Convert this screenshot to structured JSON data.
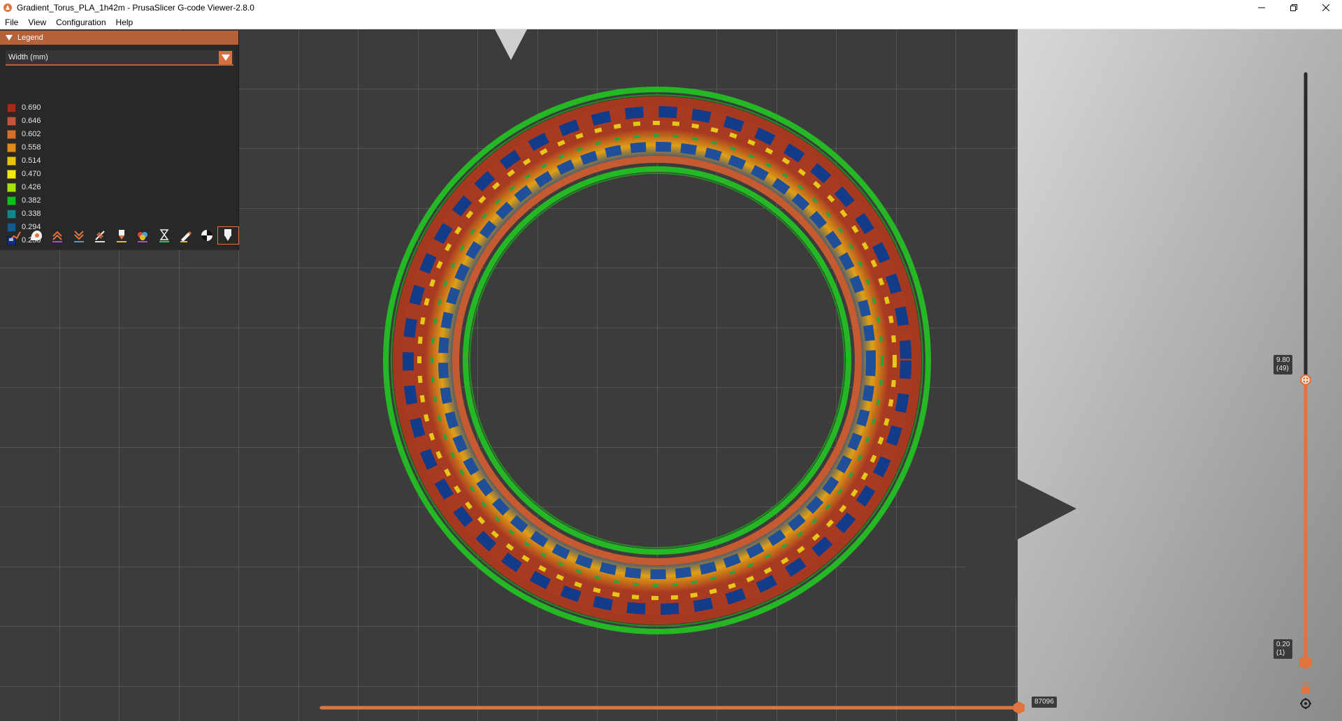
{
  "window": {
    "title": "Gradient_Torus_PLA_1h42m - PrusaSlicer G-code Viewer-2.8.0",
    "minimize_icon": "minimize-icon",
    "maximize_icon": "restore-icon",
    "close_icon": "close-icon"
  },
  "menu": {
    "items": [
      {
        "label": "File"
      },
      {
        "label": "View"
      },
      {
        "label": "Configuration"
      },
      {
        "label": "Help"
      }
    ]
  },
  "legend": {
    "title": "Legend",
    "view_type": "Width (mm)",
    "entries": [
      {
        "value": "0.690",
        "color": "#a32a1a"
      },
      {
        "value": "0.646",
        "color": "#c4553d"
      },
      {
        "value": "0.602",
        "color": "#d0702d"
      },
      {
        "value": "0.558",
        "color": "#e18a18"
      },
      {
        "value": "0.514",
        "color": "#ebc20a"
      },
      {
        "value": "0.470",
        "color": "#f3e80c"
      },
      {
        "value": "0.426",
        "color": "#a8e20f"
      },
      {
        "value": "0.382",
        "color": "#0fbf1c"
      },
      {
        "value": "0.338",
        "color": "#12868a"
      },
      {
        "value": "0.294",
        "color": "#135a8c"
      },
      {
        "value": "0.250",
        "color": "#0b2e84"
      }
    ],
    "toolbar_icons": [
      "travel-icon",
      "wipe-icon",
      "retractions-icon",
      "deretractions-icon",
      "seams-icon",
      "tool-changes-icon",
      "color-changes-icon",
      "pause-prints-icon",
      "custom-gcodes-icon",
      "center-of-gravity-icon",
      "tool-marker-icon"
    ]
  },
  "vertical_slider": {
    "upper_value": "9.80",
    "upper_layer": "(49)",
    "lower_value": "0.20",
    "lower_layer": "(1)",
    "upper_fraction": 0.48,
    "lower_fraction": 0.0,
    "lock_icon": "unlock-icon",
    "settings_icon": "cog-icon"
  },
  "horizontal_slider": {
    "value": "87096",
    "fraction": 1.0
  },
  "colors": {
    "accent": "#e0743e",
    "bed_background": "#3c3c3c",
    "grid_line": "#6a6a6a",
    "perimeter_green": "#2fbf2f"
  }
}
